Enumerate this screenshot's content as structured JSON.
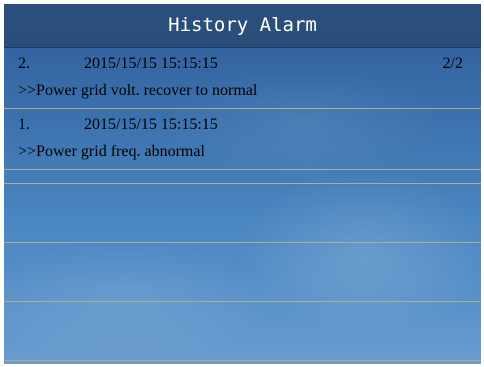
{
  "window": {
    "title": "History Alarm"
  },
  "alarms": [
    {
      "index": "2.",
      "timestamp": "2015/15/15 15:15:15",
      "page": "2/2",
      "message": ">>Power grid volt. recover to normal"
    },
    {
      "index": "1.",
      "timestamp": "2015/15/15 15:15:15",
      "page": "",
      "message": ">>Power grid freq. abnormal"
    }
  ],
  "colors": {
    "title_bar": "#2c4f7d",
    "background_top": "#2f5c98",
    "background_bottom": "#6a9ccf",
    "divider": "#b9a98a",
    "text": "#ffffff"
  }
}
